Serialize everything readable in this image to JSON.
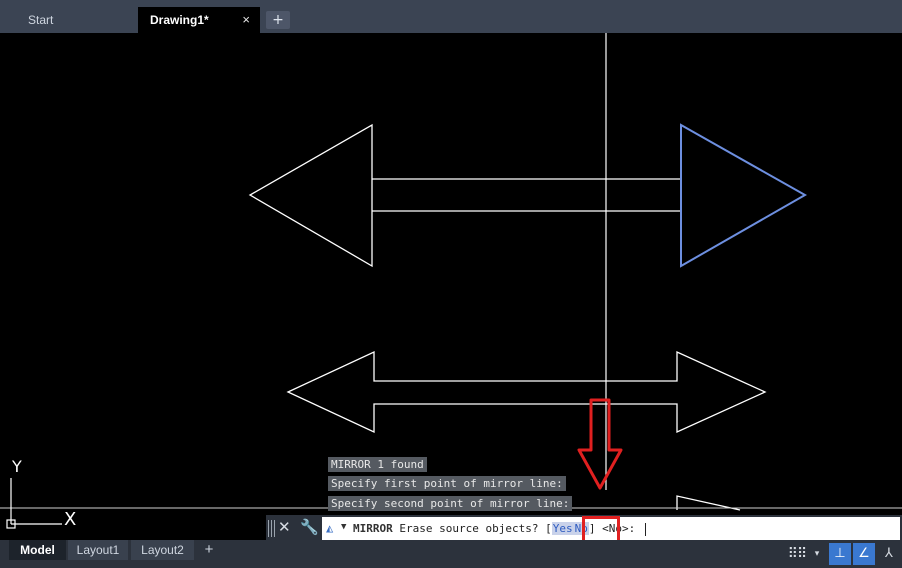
{
  "tabs": {
    "start": "Start",
    "active": "Drawing1*",
    "close": "×",
    "add": "+"
  },
  "ucs": {
    "y": "Y",
    "x": "X"
  },
  "history": [
    "MIRROR 1 found",
    "Specify first point of mirror line:",
    "Specify second point of mirror line:"
  ],
  "command": {
    "close": "✕",
    "customize": "🔧",
    "icon": "mirror-icon",
    "name": "MIRROR",
    "prompt": " Erase source objects? [",
    "opt_yes": "Yes",
    "opt_no": "No",
    "close_bracket": "]",
    "default": " <No>: "
  },
  "layouts": {
    "model": "Model",
    "layout1": "Layout1",
    "layout2": "Layout2",
    "add": "+"
  },
  "status": {
    "grid": "⠿⠿",
    "grid_dropdown": "▾",
    "snap": "⊥",
    "ortho": "∠",
    "polar": "⅄"
  },
  "colors": {
    "selected": "#5a7fd6",
    "annotation": "#e02020",
    "geometry": "#ffffff"
  }
}
